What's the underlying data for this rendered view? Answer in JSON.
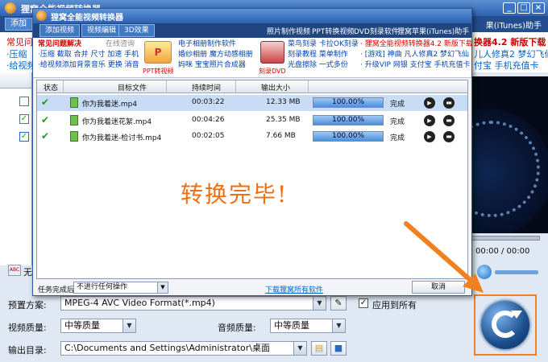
{
  "main_window": {
    "title": "狸窝全能视频转换器",
    "toolbar_add": "添加",
    "toolbar_right": "果(iTunes)助手",
    "ad_left_line1": "常见问",
    "ad_left_line2": "·压缩",
    "ad_left_line3": "·给视频",
    "ad_right_line1": "换器4.2 新版下载",
    "ad_right_line2": "儿人修真2 梦幻飞仙",
    "ad_right_line3": "付宝 手机充值卡",
    "list_item_label": "无",
    "timecode": "00:00 / 00:00",
    "preset_label": "预置方案:",
    "preset_value": "MPEG-4 AVC Video Format(*.mp4)",
    "apply_all_label": "应用到所有",
    "video_quality_label": "视频质量:",
    "video_quality_value": "中等质量",
    "audio_quality_label": "音频质量:",
    "audio_quality_value": "中等质量",
    "output_dir_label": "输出目录:",
    "output_dir_value": "C:\\Documents and Settings\\Administrator\\桌面"
  },
  "dialog": {
    "title": "狸窝全能视频转换器",
    "tabs": [
      "添加视频",
      "视频编辑",
      "3D效果"
    ],
    "top_links": [
      "照片制作视频",
      "PPT转换视频",
      "DVD刻录软件",
      "狸窝苹果(iTunes)助手"
    ],
    "ads": {
      "faq_title": "常见问题解决",
      "faq_online": "在线咨询",
      "faq_line1": "·压缩 截取 合并 尺寸 加速 手机",
      "faq_line2": "·给视频添加背景音乐 更换 消音",
      "ppt_caption": "PPT转视频",
      "photo_line1": "电子相册制作软件",
      "photo_line2": "婚纱相册 魔方动感相册",
      "photo_line3": "妈咪 宝宝照片合成器",
      "dvd_caption": "刻录DVD",
      "burn_line1": "菜鸟刻录 卡拉OK刻录",
      "burn_line2": "刻录教程 菜单制作",
      "burn_line3": "光盘擦除 一式多份",
      "promo_line1": "· 狸窝全能视频转换器4.2 新版下载",
      "promo_line2": "· [游戏] 神曲 凡人修真2 梦幻飞仙",
      "promo_line3": "· 升级VIP 网银 支付宝 手机充值卡"
    },
    "columns": [
      "状态",
      "目标文件",
      "持续时间",
      "输出大小"
    ],
    "rows": [
      {
        "file": "你为我着迷.mp4",
        "duration": "00:03:22",
        "size": "12.33 MB",
        "progress": 100,
        "progress_text": "100.00%",
        "status": "完成"
      },
      {
        "file": "你为我着迷花絮.mp4",
        "duration": "00:04:26",
        "size": "25.35 MB",
        "progress": 100,
        "progress_text": "100.00%",
        "status": "完成"
      },
      {
        "file": "你为我着迷-检讨书.mp4",
        "duration": "00:02:05",
        "size": "7.66 MB",
        "progress": 100,
        "progress_text": "100.00%",
        "status": "完成"
      }
    ],
    "complete_message": "转换完毕!",
    "after_task_label": "任务完成后:",
    "after_task_value": "不进行任何操作",
    "download_link": "下载狸窝所有软件",
    "cancel_button": "取消"
  },
  "colors": {
    "accent_orange": "#f08020",
    "title_blue": "#2f63b2",
    "complete_text": "#ef6f12"
  }
}
